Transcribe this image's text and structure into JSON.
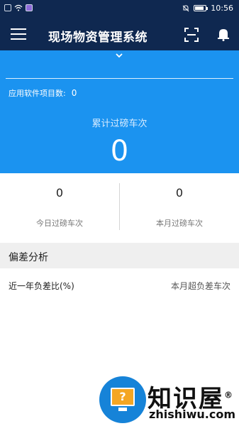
{
  "status_bar": {
    "time": "10:56",
    "battery_level": 0.85
  },
  "header": {
    "title": "现场物资管理系统",
    "icons": [
      "menu-icon",
      "scan-icon",
      "bell-icon"
    ]
  },
  "summary": {
    "apps_label": "应用软件项目数:",
    "apps_value": "0",
    "total_label": "累计过磅车次",
    "total_value": "0"
  },
  "stats": {
    "today": {
      "value": "0",
      "label": "今日过磅车次"
    },
    "month": {
      "value": "0",
      "label": "本月过磅车次"
    }
  },
  "deviation": {
    "section_title": "偏差分析",
    "left_label": "近一年负差比(%)",
    "right_label": "本月超负差车次"
  },
  "watermark": {
    "title": "知识屋",
    "subtitle": "zhishiwu.com",
    "mark": "®",
    "question": "?"
  },
  "colors": {
    "header_bg": "#0f2850",
    "hero_bg": "#1b93f0"
  }
}
